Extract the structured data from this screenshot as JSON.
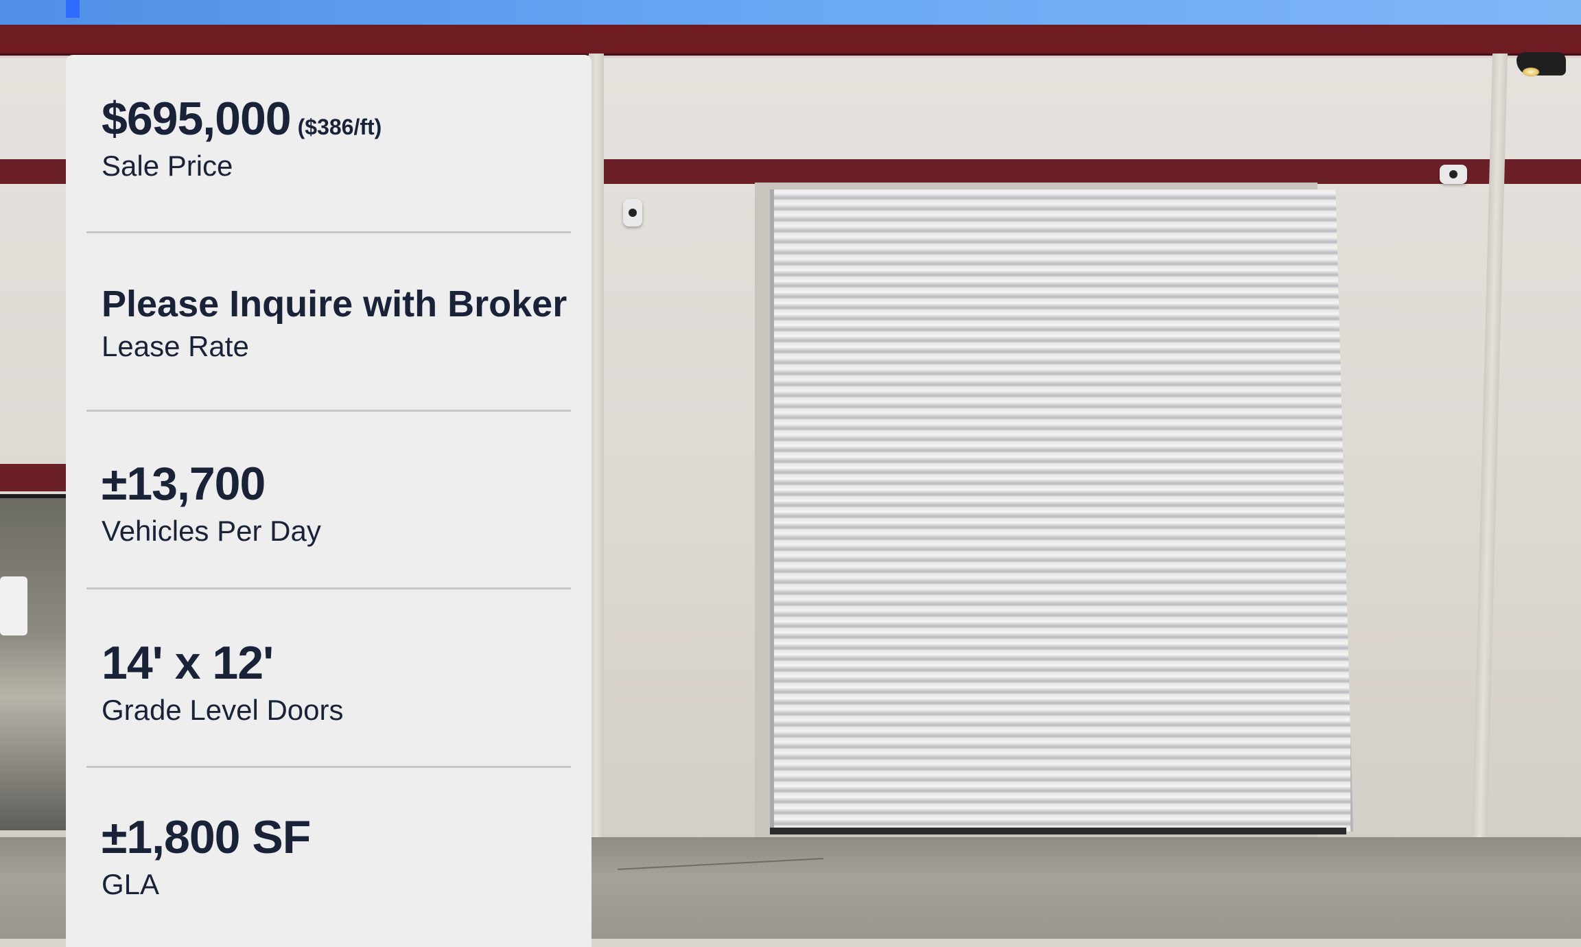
{
  "card": {
    "stats": [
      {
        "value": "$695,000",
        "per_unit": "($386/ft)",
        "label": "Sale Price"
      },
      {
        "value": "Please Inquire with Broker",
        "label": "Lease Rate"
      },
      {
        "value": "±13,700",
        "label": "Vehicles Per Day"
      },
      {
        "value": "14' x 12'",
        "label": "Grade Level Doors"
      },
      {
        "value": "±1,800 SF",
        "label": "GLA"
      }
    ]
  },
  "colors": {
    "text": "#1a2238",
    "card_background": "#eeeeee",
    "divider": "#c7c7c7",
    "building_trim": "#6b1f26"
  },
  "background": {
    "photo_subject": "industrial-building-roll-up-door"
  }
}
